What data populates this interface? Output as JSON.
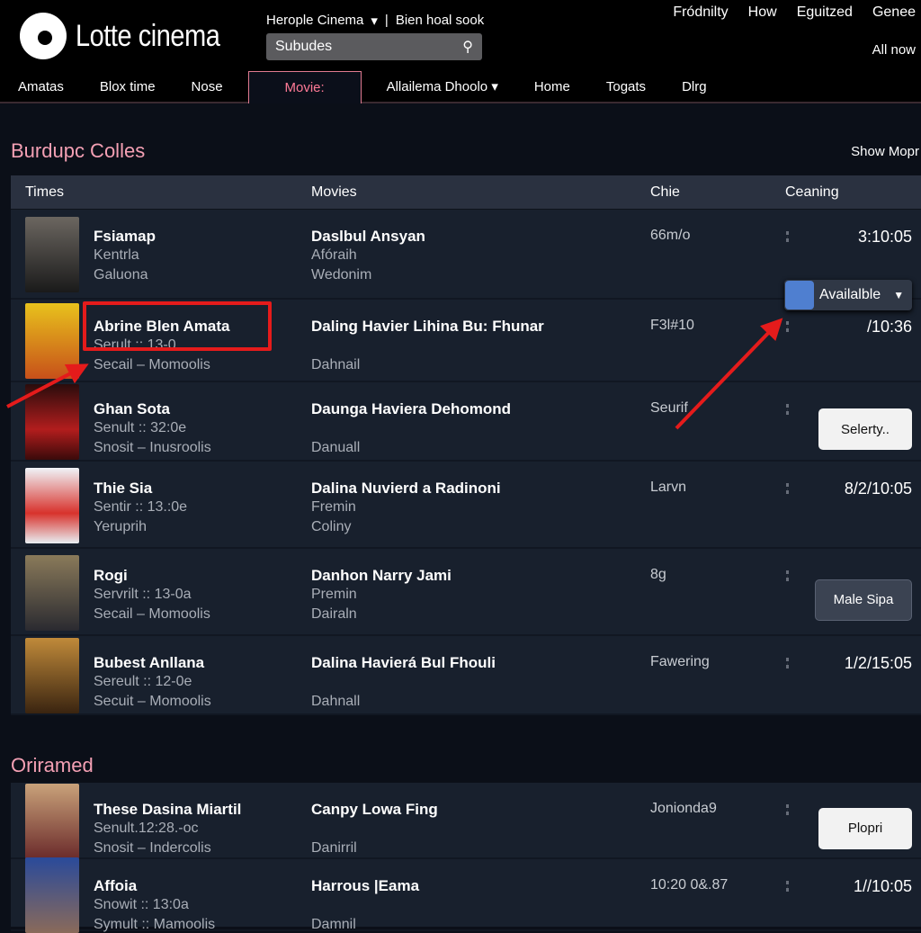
{
  "header": {
    "logo": "Lotte cinema",
    "location": "Herople Cinema",
    "location_sep": "|",
    "location_extra": "Bien hoal sook",
    "search_value": "Subudes",
    "top_links": [
      "Fródnilty",
      "How",
      "Eguitzed",
      "Genee"
    ],
    "all_now": "All now"
  },
  "nav": [
    "Amatas",
    "Blox time",
    "Nose",
    "Movie:",
    "Allailema Dhoolo",
    "Home",
    "Togats",
    "Dlrg"
  ],
  "nav_active": "Movie:",
  "section1": {
    "title": "Burdupc Colles",
    "show_more": "Show Mopr",
    "columns": [
      "Times",
      "Movies",
      "Chie",
      "Ceaning"
    ],
    "rows": [
      {
        "title": "Fsiamap",
        "sub1": "Kentrla",
        "sub2": "Galuona",
        "movie": "Daslbul Ansyan",
        "m1": "Afóraih",
        "m2": "Wedonim",
        "chie": "66m/o",
        "time": "3:10:05"
      },
      {
        "title": "Abrine Blen Amata",
        "sub1": "Serult :: 13-0",
        "sub2": "Secail – Momoolis",
        "movie": "Daling Havier Lihina Bu: Fhunar",
        "m1": "",
        "m2": "Dahnail",
        "chie": "F3l#10",
        "time": "/10:36"
      },
      {
        "title": "Ghan Sota",
        "sub1": "Senult :: 32:0e",
        "sub2": "Snosit – Inusroolis",
        "movie": "Daunga Haviera Dehomond",
        "m1": "",
        "m2": "Danuall",
        "chie": "Seurif",
        "button": "Selerty.."
      },
      {
        "title": "Thie Sia",
        "sub1": "Sentir :: 13.:0e",
        "sub2": "Yeruprih",
        "movie": "Dalina Nuvierd a Radinoni",
        "m1": "Fremin",
        "m2": "Coliny",
        "chie": "Larvn",
        "time": "8/2/10:05"
      },
      {
        "title": "Rogi",
        "sub1": "Servrilt :: 13-0a",
        "sub2": "Secail – Momoolis",
        "movie": "Danhon Narry Jami",
        "m1": "Premin",
        "m2": "Dairaln",
        "chie": "8g",
        "button": "Male Sipa"
      },
      {
        "title": "Bubest Anllana",
        "sub1": "Sereult :: 12-0e",
        "sub2": "Secuit – Momoolis",
        "movie": "Dalina Havierá Bul Fhouli",
        "m1": "",
        "m2": "Dahnall",
        "chie": "Fawering",
        "time": "1/2/15:05"
      }
    ],
    "dropdown": "Availalble"
  },
  "section2": {
    "title": "Oriramed",
    "rows": [
      {
        "title": "These Dasina Miartil",
        "sub1": "Senult.12:28.-oc",
        "sub2": "Snosit – Indercolis",
        "movie": "Canpy Lowa Fing",
        "m2": "Danirril",
        "chie": "Jonionda9",
        "button": "Plopri"
      },
      {
        "title": "Affoia",
        "sub1": "Snowit :: 13:0a",
        "sub2": "Symult :: Mamoolis",
        "movie": "Harrous |Eama",
        "m2": "Damnil",
        "chie": "10:20 0&.87",
        "time": "1//10:05"
      }
    ]
  },
  "colors": {
    "accent": "#ff7a96",
    "annotation": "#e51b1b",
    "dropdown_icon": "#4f7fd0"
  }
}
